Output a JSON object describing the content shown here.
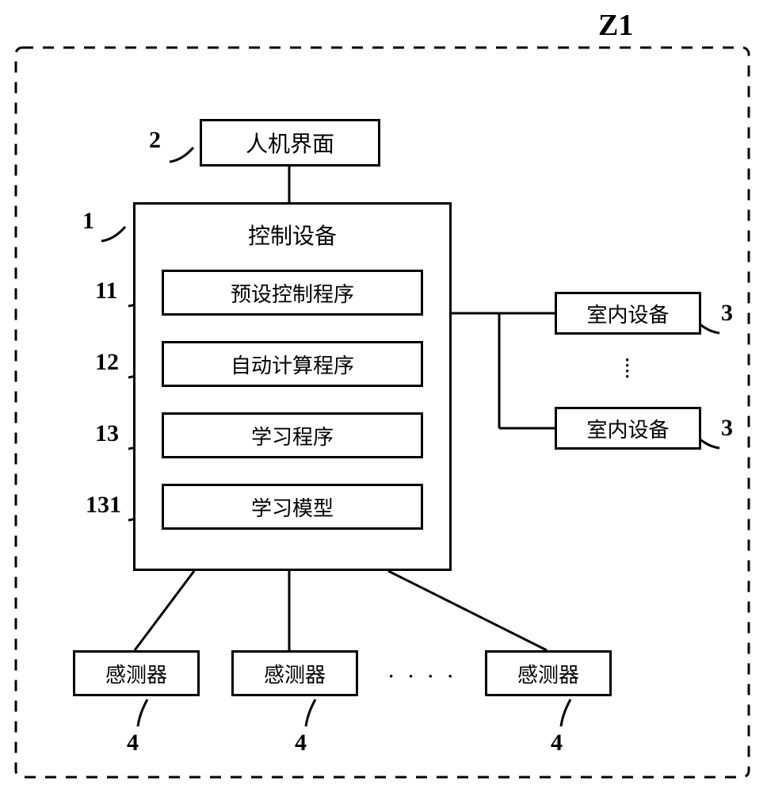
{
  "system_label": "Z1",
  "blocks": {
    "hmi": {
      "ref": "2",
      "text": "人机界面"
    },
    "ctrl": {
      "ref": "1",
      "text": "控制设备"
    },
    "preset": {
      "ref": "11",
      "text": "预设控制程序"
    },
    "auto": {
      "ref": "12",
      "text": "自动计算程序"
    },
    "learn": {
      "ref": "13",
      "text": "学习程序"
    },
    "model": {
      "ref": "131",
      "text": "学习模型"
    },
    "indoor1": {
      "ref": "3",
      "text": "室内设备"
    },
    "indoor2": {
      "ref": "3",
      "text": "室内设备"
    },
    "sensor1": {
      "ref": "4",
      "text": "感测器"
    },
    "sensor2": {
      "ref": "4",
      "text": "感测器"
    },
    "sensor3": {
      "ref": "4",
      "text": "感测器"
    }
  },
  "chart_data": {
    "type": "block-diagram",
    "title": "",
    "system_id": "Z1",
    "nodes": [
      {
        "id": "hmi",
        "ref": "2",
        "label": "人机界面"
      },
      {
        "id": "ctrl",
        "ref": "1",
        "label": "控制设备",
        "children": [
          {
            "id": "preset",
            "ref": "11",
            "label": "预设控制程序"
          },
          {
            "id": "auto",
            "ref": "12",
            "label": "自动计算程序"
          },
          {
            "id": "learn",
            "ref": "13",
            "label": "学习程序"
          },
          {
            "id": "model",
            "ref": "131",
            "label": "学习模型"
          }
        ]
      },
      {
        "id": "indoor1",
        "ref": "3",
        "label": "室内设备"
      },
      {
        "id": "indoor2",
        "ref": "3",
        "label": "室内设备"
      },
      {
        "id": "sensor1",
        "ref": "4",
        "label": "感测器"
      },
      {
        "id": "sensor2",
        "ref": "4",
        "label": "感测器"
      },
      {
        "id": "sensor3",
        "ref": "4",
        "label": "感测器"
      }
    ],
    "edges": [
      {
        "from": "hmi",
        "to": "ctrl"
      },
      {
        "from": "ctrl",
        "to": "indoor1"
      },
      {
        "from": "ctrl",
        "to": "indoor2"
      },
      {
        "from": "ctrl",
        "to": "sensor1"
      },
      {
        "from": "ctrl",
        "to": "sensor2"
      },
      {
        "from": "ctrl",
        "to": "sensor3"
      }
    ],
    "repeated_groups": [
      {
        "kind": "indoor",
        "ref": "3",
        "shown": 2,
        "more": true
      },
      {
        "kind": "sensor",
        "ref": "4",
        "shown": 3,
        "more": true
      }
    ]
  }
}
